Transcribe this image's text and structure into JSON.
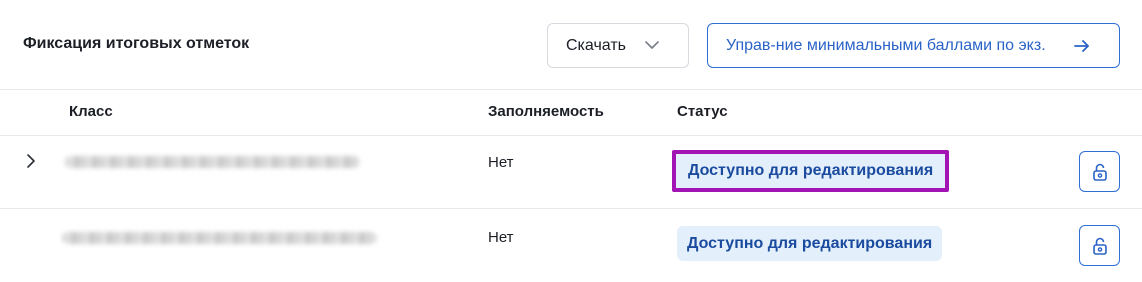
{
  "header": {
    "title": "Фиксация итоговых отметок",
    "download_label": "Скачать",
    "manage_label": "Управ-ние минимальными баллами по экз."
  },
  "table": {
    "columns": [
      "Класс",
      "Заполняемость",
      "Статус"
    ],
    "rows": [
      {
        "fill": "Нет",
        "status": "Доступно для редактирования"
      },
      {
        "fill": "Нет",
        "status": "Доступно для редактирования"
      }
    ]
  },
  "colors": {
    "accent": "#2f6fd6",
    "status_bg": "#e4effc",
    "status_text": "#1a4b9e",
    "highlight_border": "#a214b3"
  },
  "icons": [
    "chevron-down-icon",
    "arrow-right-icon",
    "chevron-right-icon",
    "lock-icon"
  ]
}
